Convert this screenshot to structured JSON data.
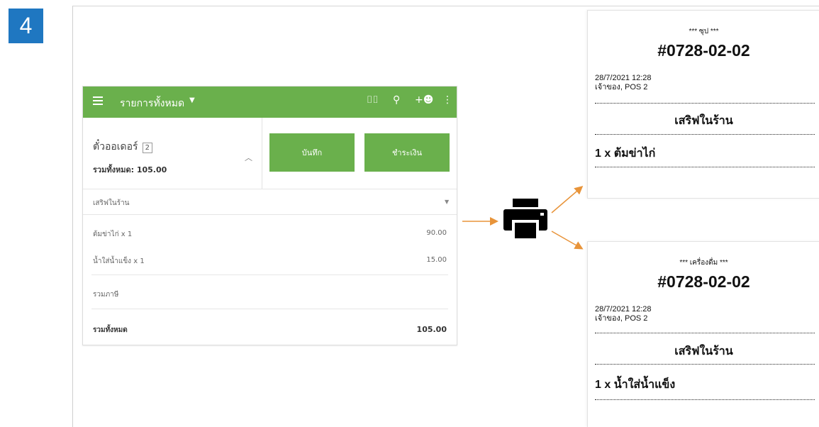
{
  "step": "4",
  "pos": {
    "title": "รายการทั้งหมด",
    "ticket_label": "ตั๋วออเดอร์",
    "ticket_count": "2",
    "total_line": "รวมทั้งหมด: 105.00",
    "save_label": "บันทึก",
    "pay_label": "ชำระเงิน",
    "dining_option": "เสริฟในร้าน",
    "items": [
      {
        "name": "ต้มข่าไก่ x 1",
        "price": "90.00"
      },
      {
        "name": "น้ำใส่น้ำแข็ง x 1",
        "price": "15.00"
      }
    ],
    "tax_label": "รวมภาษี",
    "grand_total_label": "รวมทั้งหมด",
    "grand_total_value": "105.00"
  },
  "receipts": [
    {
      "category": "*** ซุป ***",
      "order_no": "#0728-02-02",
      "datetime": "28/7/2021 12:28",
      "cashier": "เจ้าของ, POS 2",
      "dining": "เสริฟในร้าน",
      "item": "1 x ต้มข่าไก่"
    },
    {
      "category": "*** เครื่องดื่ม ***",
      "order_no": "#0728-02-02",
      "datetime": "28/7/2021 12:28",
      "cashier": "เจ้าของ, POS 2",
      "dining": "เสริฟในร้าน",
      "item": "1 x น้ำใส่น้ำแข็ง"
    }
  ],
  "colors": {
    "badge": "#1f77c1",
    "app_green": "#6ab04c",
    "arrow": "#e8943a"
  },
  "icons": [
    "menu-icon",
    "caret-down-icon",
    "barcode-icon",
    "search-icon",
    "add-customer-icon",
    "more-vert-icon",
    "chevron-up-icon",
    "printer-icon"
  ]
}
